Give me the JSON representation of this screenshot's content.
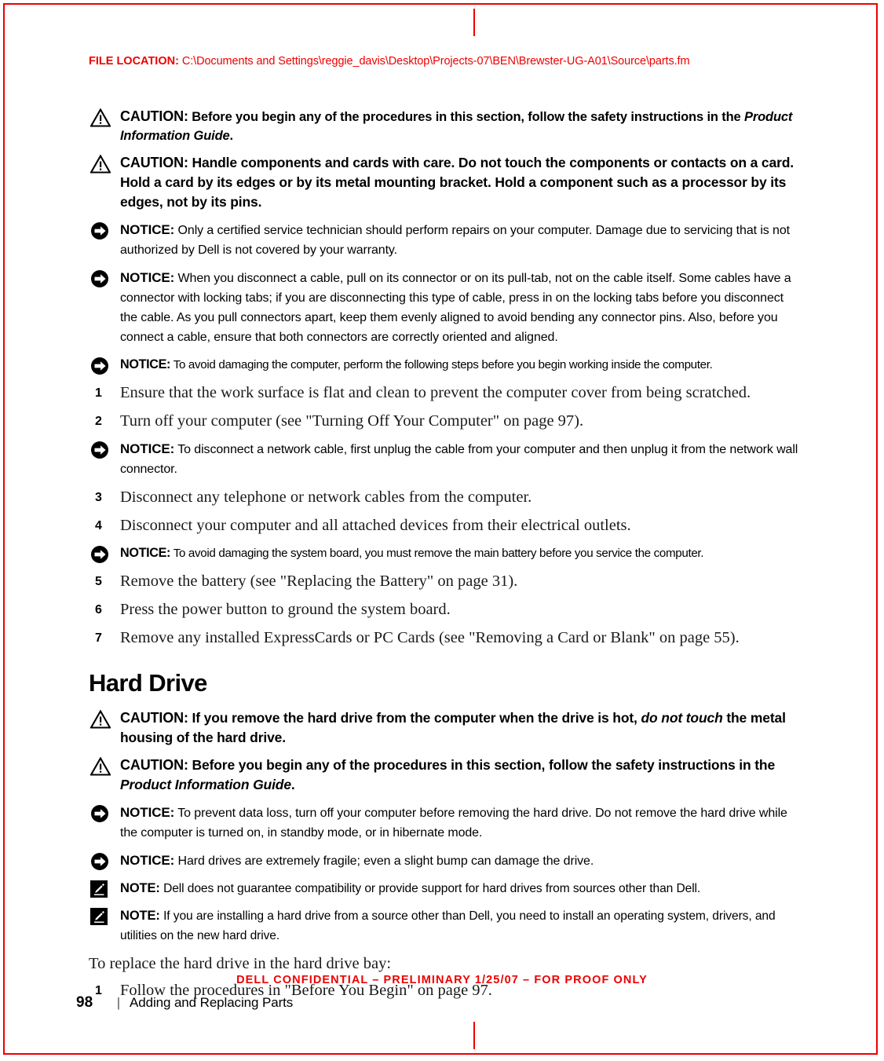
{
  "header": {
    "file_location_label": "FILE LOCATION:",
    "file_location_path": "C:\\Documents and Settings\\reggie_davis\\Desktop\\Projects-07\\BEN\\Brewster-UG-A01\\Source\\parts.fm"
  },
  "labels": {
    "caution": "CAUTION:",
    "notice": "NOTICE:",
    "note": "NOTE:"
  },
  "blocks": {
    "caution_1_text": "Before you begin any of the procedures in this section, follow the safety instructions in the ",
    "caution_1_italic": "Product Information Guide",
    "caution_1_tail": ".",
    "caution_2_text": "Handle components and cards with care. Do not touch the components or contacts on a card. Hold a card by its edges or by its metal mounting bracket. Hold a component such as a processor by its edges, not by its pins.",
    "notice_1_text": "Only a certified service technician should perform repairs on your computer. Damage due to servicing that is not authorized by Dell is not covered by your warranty.",
    "notice_2_text": "When you disconnect a cable, pull on its connector or on its pull-tab, not on the cable itself. Some cables have a connector with locking tabs; if you are disconnecting this type of cable, press in on the locking tabs before you disconnect the cable. As you pull connectors apart, keep them evenly aligned to avoid bending any connector pins. Also, before you connect a cable, ensure that both connectors are correctly oriented and aligned.",
    "notice_3_text": "To avoid damaging the computer, perform the following steps before you begin working inside the computer.",
    "notice_4_text": "To disconnect a network cable, first unplug the cable from your computer and then unplug it from the network wall connector.",
    "notice_5_text": "To avoid damaging the system board, you must remove the main battery before you service the computer.",
    "caution_3_pre": "If you remove the hard drive from the computer when the drive is hot, ",
    "caution_3_italic": "do not touch",
    "caution_3_post": " the metal housing of the hard drive.",
    "caution_4_text": "Before you begin any of the procedures in this section, follow the safety instructions in the ",
    "caution_4_italic": "Product Information Guide",
    "caution_4_tail": ".",
    "notice_6_text": "To prevent data loss, turn off your computer before removing the hard drive. Do not remove the hard drive while the computer is turned on, in standby mode, or in hibernate mode.",
    "notice_7_text": "Hard drives are extremely fragile; even a slight bump can damage the drive.",
    "note_1_text": "Dell does not guarantee compatibility or provide support for hard drives from sources other than Dell.",
    "note_2_text": "If you are installing a hard drive from a source other than Dell, you need to install an operating system, drivers, and utilities on the new hard drive."
  },
  "steps_before_you_begin": [
    {
      "num": "1",
      "text": "Ensure that the work surface is flat and clean to prevent the computer cover from being scratched."
    },
    {
      "num": "2",
      "text": "Turn off your computer (see \"Turning Off Your Computer\" on page 97)."
    },
    {
      "num": "3",
      "text": "Disconnect any telephone or network cables from the computer."
    },
    {
      "num": "4",
      "text": "Disconnect your computer and all attached devices from their electrical outlets."
    },
    {
      "num": "5",
      "text": "Remove the battery (see \"Replacing the Battery\" on page 31)."
    },
    {
      "num": "6",
      "text": "Press the power button to ground the system board."
    },
    {
      "num": "7",
      "text": "Remove any installed ExpressCards or PC Cards (see \"Removing a Card or Blank\" on page 55)."
    }
  ],
  "section": {
    "hard_drive_title": "Hard Drive",
    "replace_intro": "To replace the hard drive in the hard drive bay:",
    "replace_step_1_num": "1",
    "replace_step_1_text": "Follow the procedures in \"Before You Begin\" on page 97."
  },
  "footer": {
    "confidential": "DELL CONFIDENTIAL – PRELIMINARY 1/25/07 – FOR PROOF ONLY",
    "page_number": "98",
    "rule": "|",
    "chapter_title": "Adding and Replacing Parts"
  },
  "colors": {
    "red": "#ee0000",
    "text": "#000000",
    "body_serif": "#1a1a1a"
  }
}
